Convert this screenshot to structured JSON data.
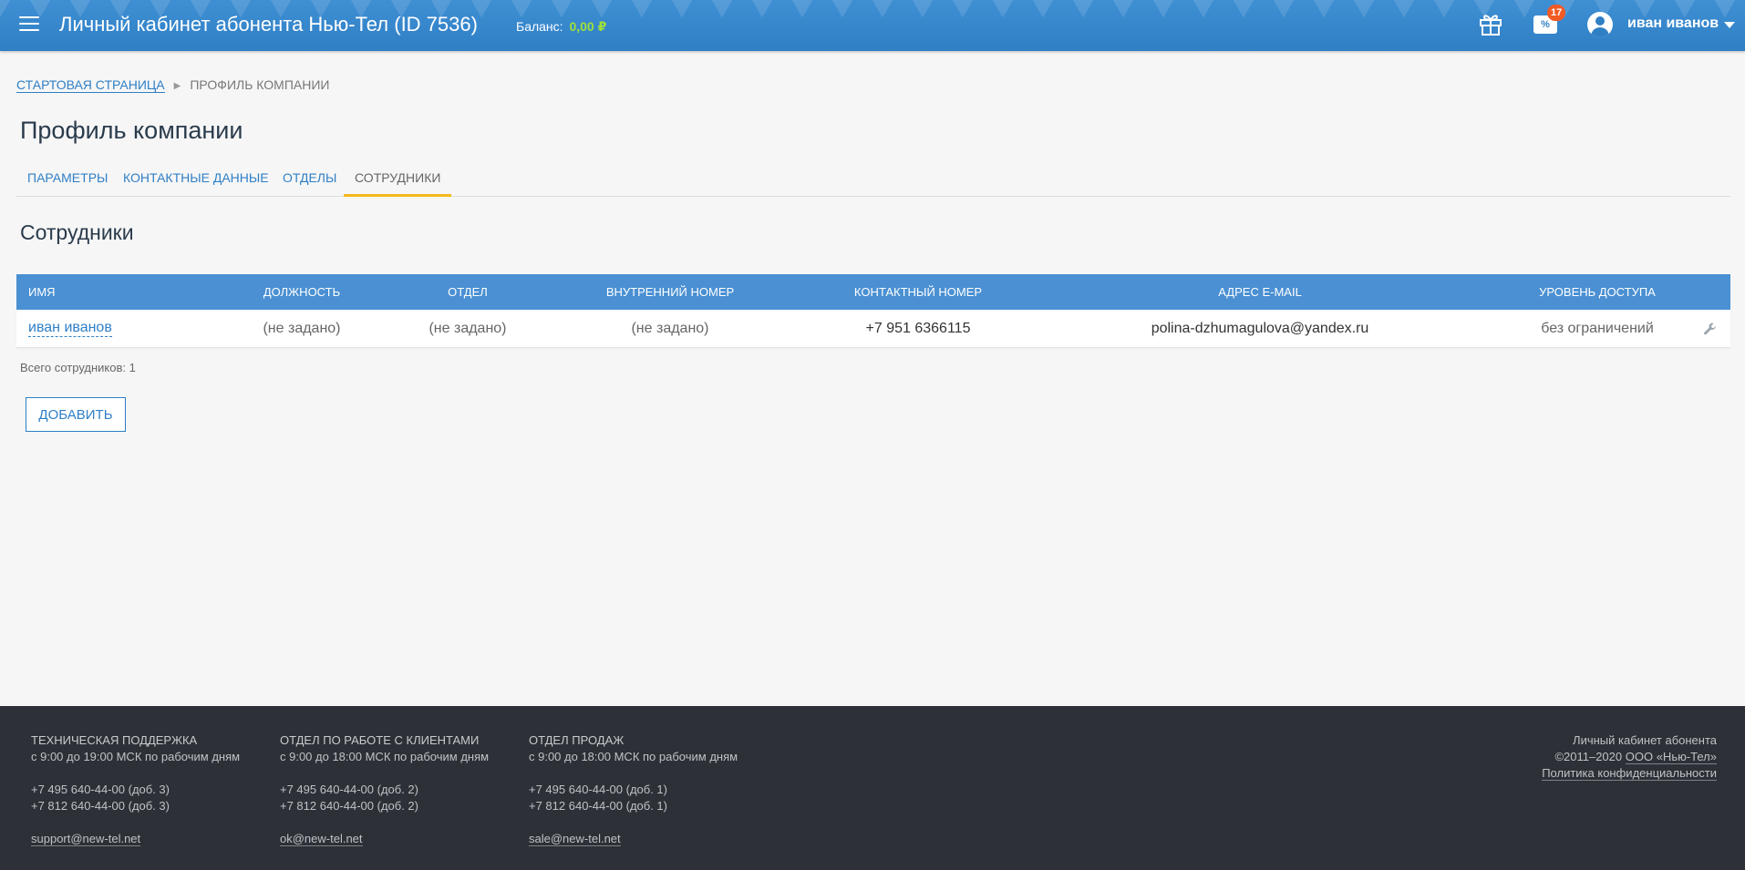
{
  "header": {
    "title": "Личный кабинет абонента Нью-Тел (ID 7536)",
    "balance_label": "Баланс:",
    "balance_value": "0,00 ₽",
    "promo_tag": "%",
    "promo_badge": "17",
    "user_name": "иван иванов",
    "colors": {
      "bar": "#2f7fc6",
      "balance": "#9fe03b",
      "badge": "#f15a24"
    }
  },
  "breadcrumb": {
    "home": "Стартовая страница",
    "current": "Профиль компании"
  },
  "page_title": "Профиль компании",
  "tabs": [
    {
      "label": "Параметры",
      "active": false
    },
    {
      "label": "Контактные данные",
      "active": false
    },
    {
      "label": "Отделы",
      "active": false
    },
    {
      "label": "Сотрудники",
      "active": true
    }
  ],
  "section_title": "Сотрудники",
  "table": {
    "columns": [
      "Имя",
      "Должность",
      "Отдел",
      "Внутренний номер",
      "Контактный номер",
      "Адрес e-mail",
      "Уровень доступа"
    ],
    "rows": [
      {
        "name": "иван иванов",
        "position": "(не задано)",
        "department": "(не задано)",
        "internal": "(не задано)",
        "phone": "+7 951 6366115",
        "email": "polina-dzhumagulova@yandex.ru",
        "access": "без ограничений"
      }
    ]
  },
  "total": "Всего сотрудников: 1",
  "add_button": "Добавить",
  "footer": {
    "support": {
      "title": "Техническая поддержка",
      "hours": "с 9:00 до 19:00 МСК по рабочим дням",
      "phone1": "+7 495 640-44-00  (доб. 3)",
      "phone2": "+7 812 640-44-00  (доб. 3)",
      "email": "support@new-tel.net"
    },
    "clients": {
      "title": "Отдел по работе с клиентами",
      "hours": "с 9:00 до 18:00 МСК по рабочим дням",
      "phone1": "+7 495 640-44-00  (доб. 2)",
      "phone2": "+7 812 640-44-00  (доб. 2)",
      "email": "ok@new-tel.net"
    },
    "sales": {
      "title": "Отдел продаж",
      "hours": "с 9:00 до 18:00 МСК по рабочим дням",
      "phone1": "+7 495 640-44-00  (доб. 1)",
      "phone2": "+7 812 640-44-00  (доб. 1)",
      "email": "sale@new-tel.net"
    },
    "right": {
      "line1": "Личный кабинет абонента",
      "copyright": "©2011–2020",
      "company": "ООО «Нью-Тел»",
      "privacy": "Политика конфиденциальности"
    }
  }
}
